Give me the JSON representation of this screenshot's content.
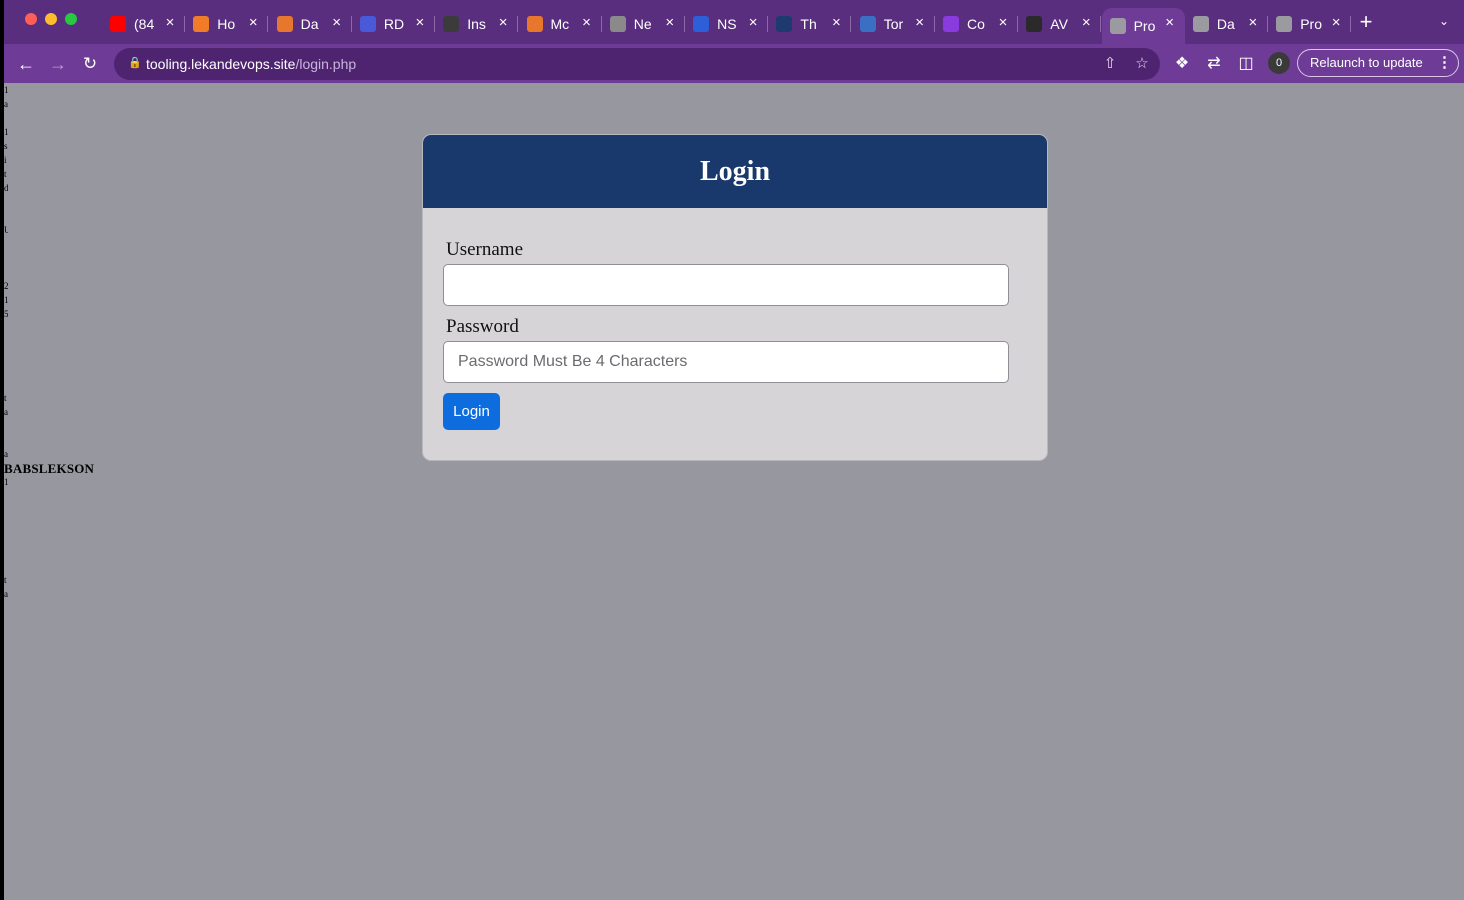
{
  "browser": {
    "tabs": [
      {
        "title": "(84",
        "icon": "youtube-icon",
        "color": "#ff0000"
      },
      {
        "title": "Ho",
        "icon": "cube-icon",
        "color": "#f07c2a"
      },
      {
        "title": "Da",
        "icon": "aws-service-icon",
        "color": "#e8772e"
      },
      {
        "title": "RD",
        "icon": "rds-icon",
        "color": "#4a59d8"
      },
      {
        "title": "Ins",
        "icon": "folder-icon",
        "color": "#3b3b3b"
      },
      {
        "title": "Mc",
        "icon": "aws-service-icon",
        "color": "#e8772e"
      },
      {
        "title": "Ne",
        "icon": "chrome-icon",
        "color": "#8a8a8a"
      },
      {
        "title": "NS",
        "icon": "n-logo-icon",
        "color": "#2d5fd8"
      },
      {
        "title": "Th",
        "icon": "bird-logo-icon",
        "color": "#1f3a6e"
      },
      {
        "title": "Tor",
        "icon": "t-logo-icon",
        "color": "#3a6fc4"
      },
      {
        "title": "Co",
        "icon": "shield-logo-icon",
        "color": "#8a3be0"
      },
      {
        "title": "AV",
        "icon": "bracket-icon",
        "color": "#2a2a2a"
      },
      {
        "title": "Pro",
        "icon": "globe-icon",
        "color": "#9a9aa0",
        "active": true
      },
      {
        "title": "Da",
        "icon": "globe-icon",
        "color": "#9a9aa0"
      },
      {
        "title": "Pro",
        "icon": "globe-icon",
        "color": "#9a9aa0"
      }
    ],
    "url_host": "tooling.lekandevops.site",
    "url_path": "/login.php",
    "profile_count": "0",
    "relaunch_label": "Relaunch to update"
  },
  "page": {
    "side_name": "BABSLEKSON",
    "left_strip_chars": [
      "1",
      "a",
      "",
      "1",
      "s",
      "i",
      "t",
      "d",
      "",
      "",
      "U",
      "",
      "",
      "",
      "2",
      "1",
      "5",
      "",
      "",
      "",
      "",
      "",
      "t",
      "a",
      "",
      "",
      "a",
      "",
      "1",
      "",
      "",
      "",
      "",
      "",
      "",
      "t",
      "a"
    ],
    "card": {
      "title": "Login",
      "username_label": "Username",
      "username_value": "",
      "password_label": "Password",
      "password_placeholder": "Password Must Be 4 Characters",
      "submit_label": "Login"
    }
  },
  "colors": {
    "tabstrip": "#5a2e7e",
    "toolbar": "#6e3c96",
    "page_background": "#96979f",
    "card_header": "#19386b",
    "card_body": "#d6d4d7",
    "login_button": "#0d6ddf"
  }
}
